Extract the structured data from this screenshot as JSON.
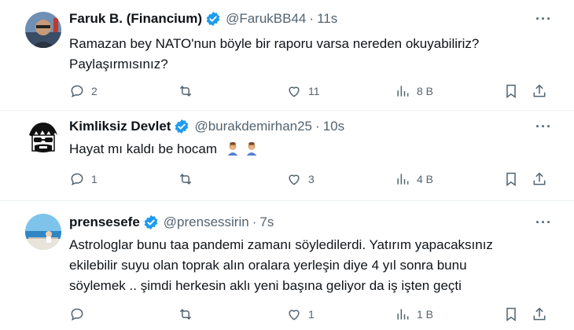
{
  "tweets": [
    {
      "name": "Faruk B. (Financium)",
      "handle": "@FarukBB44",
      "separator": "·",
      "time": "11s",
      "text_lines": [
        "Ramazan bey NATO'nun böyle bir raporu varsa nereden okuyabiliriz?",
        "Paylaşırmısınız?"
      ],
      "reply_count": "2",
      "retweet_count": "",
      "like_count": "11",
      "view_count": "8 B",
      "more": "···"
    },
    {
      "name": "Kimliksiz Devlet",
      "handle": "@burakdemirhan25",
      "separator": "·",
      "time": "10s",
      "text_lines": [
        "Hayat mı kaldı be hocam"
      ],
      "emojis": [
        "facepalm-emoji",
        "facepalm-emoji"
      ],
      "reply_count": "1",
      "retweet_count": "",
      "like_count": "3",
      "view_count": "4 B",
      "more": "···"
    },
    {
      "name": "prensesefe",
      "handle": "@prensessirin",
      "separator": "·",
      "time": "7s",
      "text_lines": [
        "Astrologlar bunu taa pandemi zamanı söyledilerdi. Yatırım yapacaksınız",
        "ekilebilir suyu olan toprak alın oralara yerleşin  diye  4 yıl sonra bunu",
        "söylemek .. şimdi herkesin aklı yeni başına geliyor da iş işten geçti"
      ],
      "reply_count": "",
      "retweet_count": "",
      "like_count": "1",
      "view_count": "1 B",
      "more": "···"
    }
  ],
  "icons": {
    "verified": "verified-badge-icon",
    "reply": "reply-icon",
    "retweet": "retweet-icon",
    "like": "heart-icon",
    "views": "views-icon",
    "bookmark": "bookmark-icon",
    "share": "share-icon"
  },
  "colors": {
    "verified": "#1d9bf0",
    "text": "#0f1419",
    "muted": "#536471",
    "divider": "#eff3f4"
  }
}
